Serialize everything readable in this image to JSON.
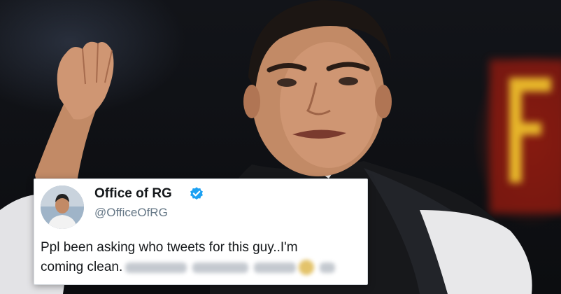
{
  "tweet": {
    "display_name": "Office of RG",
    "handle": "@OfficeOfRG",
    "verified": true,
    "text_line1": "Ppl been asking who tweets for this guy..I'm",
    "text_line2_visible": "coming clean.",
    "text_line2_obscured": true
  },
  "colors": {
    "verified_badge": "#1da1f2",
    "name_text": "#14171a",
    "handle_text": "#657786",
    "card_bg": "#ffffff"
  },
  "icons": {
    "verified": "verified-badge-icon"
  }
}
